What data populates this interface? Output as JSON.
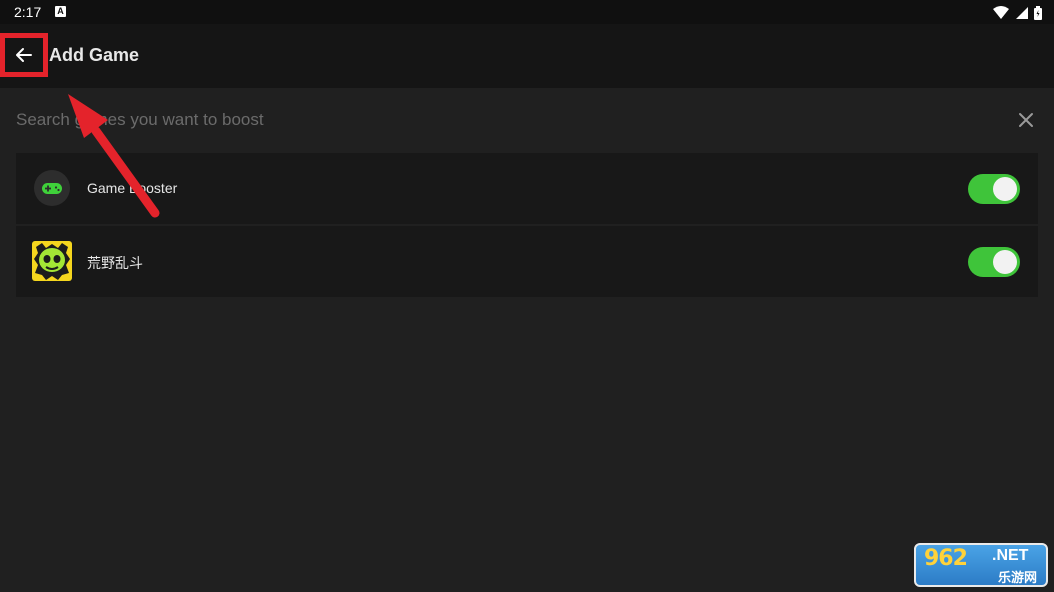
{
  "status_bar": {
    "time": "2:17",
    "notification_icon": "a-letter-icon",
    "icons": [
      "wifi-icon",
      "signal-icon",
      "battery-icon"
    ]
  },
  "app_bar": {
    "title": "Add Game",
    "back_icon": "arrow-left-icon"
  },
  "search": {
    "value": "",
    "placeholder": "Search games you want to boost",
    "clear_icon": "close-icon"
  },
  "games": [
    {
      "name": "Game Booster",
      "icon": "gamepad-icon",
      "enabled": true
    },
    {
      "name": "荒野乱斗",
      "icon": "brawl-stars-skull-icon",
      "enabled": true
    }
  ],
  "colors": {
    "background": "#202020",
    "app_bar": "#151515",
    "row": "#181818",
    "toggle_on": "#3fc43a",
    "annotation_red": "#e4232b"
  },
  "watermark": {
    "brand": "962",
    "domain": ".NET",
    "sub": "乐游网"
  }
}
